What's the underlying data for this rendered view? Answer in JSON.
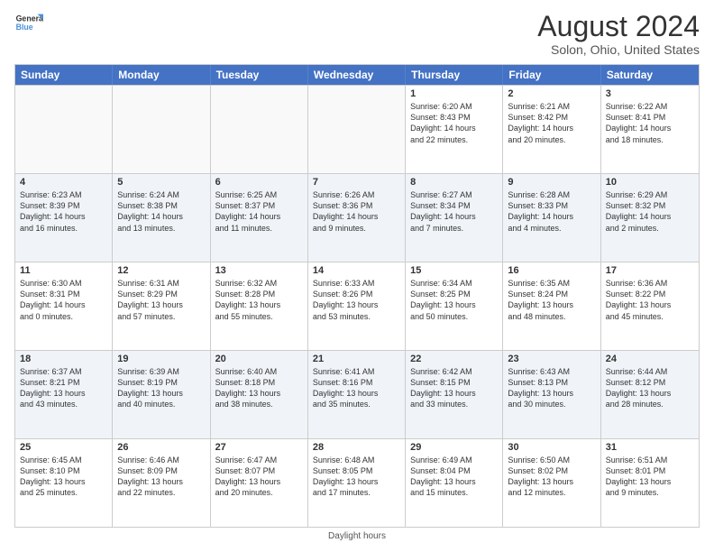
{
  "header": {
    "logo_general": "General",
    "logo_blue": "Blue",
    "month_year": "August 2024",
    "location": "Solon, Ohio, United States"
  },
  "days_of_week": [
    "Sunday",
    "Monday",
    "Tuesday",
    "Wednesday",
    "Thursday",
    "Friday",
    "Saturday"
  ],
  "footer": {
    "daylight_label": "Daylight hours"
  },
  "weeks": [
    [
      {
        "day": "",
        "info": ""
      },
      {
        "day": "",
        "info": ""
      },
      {
        "day": "",
        "info": ""
      },
      {
        "day": "",
        "info": ""
      },
      {
        "day": "1",
        "info": "Sunrise: 6:20 AM\nSunset: 8:43 PM\nDaylight: 14 hours\nand 22 minutes."
      },
      {
        "day": "2",
        "info": "Sunrise: 6:21 AM\nSunset: 8:42 PM\nDaylight: 14 hours\nand 20 minutes."
      },
      {
        "day": "3",
        "info": "Sunrise: 6:22 AM\nSunset: 8:41 PM\nDaylight: 14 hours\nand 18 minutes."
      }
    ],
    [
      {
        "day": "4",
        "info": "Sunrise: 6:23 AM\nSunset: 8:39 PM\nDaylight: 14 hours\nand 16 minutes."
      },
      {
        "day": "5",
        "info": "Sunrise: 6:24 AM\nSunset: 8:38 PM\nDaylight: 14 hours\nand 13 minutes."
      },
      {
        "day": "6",
        "info": "Sunrise: 6:25 AM\nSunset: 8:37 PM\nDaylight: 14 hours\nand 11 minutes."
      },
      {
        "day": "7",
        "info": "Sunrise: 6:26 AM\nSunset: 8:36 PM\nDaylight: 14 hours\nand 9 minutes."
      },
      {
        "day": "8",
        "info": "Sunrise: 6:27 AM\nSunset: 8:34 PM\nDaylight: 14 hours\nand 7 minutes."
      },
      {
        "day": "9",
        "info": "Sunrise: 6:28 AM\nSunset: 8:33 PM\nDaylight: 14 hours\nand 4 minutes."
      },
      {
        "day": "10",
        "info": "Sunrise: 6:29 AM\nSunset: 8:32 PM\nDaylight: 14 hours\nand 2 minutes."
      }
    ],
    [
      {
        "day": "11",
        "info": "Sunrise: 6:30 AM\nSunset: 8:31 PM\nDaylight: 14 hours\nand 0 minutes."
      },
      {
        "day": "12",
        "info": "Sunrise: 6:31 AM\nSunset: 8:29 PM\nDaylight: 13 hours\nand 57 minutes."
      },
      {
        "day": "13",
        "info": "Sunrise: 6:32 AM\nSunset: 8:28 PM\nDaylight: 13 hours\nand 55 minutes."
      },
      {
        "day": "14",
        "info": "Sunrise: 6:33 AM\nSunset: 8:26 PM\nDaylight: 13 hours\nand 53 minutes."
      },
      {
        "day": "15",
        "info": "Sunrise: 6:34 AM\nSunset: 8:25 PM\nDaylight: 13 hours\nand 50 minutes."
      },
      {
        "day": "16",
        "info": "Sunrise: 6:35 AM\nSunset: 8:24 PM\nDaylight: 13 hours\nand 48 minutes."
      },
      {
        "day": "17",
        "info": "Sunrise: 6:36 AM\nSunset: 8:22 PM\nDaylight: 13 hours\nand 45 minutes."
      }
    ],
    [
      {
        "day": "18",
        "info": "Sunrise: 6:37 AM\nSunset: 8:21 PM\nDaylight: 13 hours\nand 43 minutes."
      },
      {
        "day": "19",
        "info": "Sunrise: 6:39 AM\nSunset: 8:19 PM\nDaylight: 13 hours\nand 40 minutes."
      },
      {
        "day": "20",
        "info": "Sunrise: 6:40 AM\nSunset: 8:18 PM\nDaylight: 13 hours\nand 38 minutes."
      },
      {
        "day": "21",
        "info": "Sunrise: 6:41 AM\nSunset: 8:16 PM\nDaylight: 13 hours\nand 35 minutes."
      },
      {
        "day": "22",
        "info": "Sunrise: 6:42 AM\nSunset: 8:15 PM\nDaylight: 13 hours\nand 33 minutes."
      },
      {
        "day": "23",
        "info": "Sunrise: 6:43 AM\nSunset: 8:13 PM\nDaylight: 13 hours\nand 30 minutes."
      },
      {
        "day": "24",
        "info": "Sunrise: 6:44 AM\nSunset: 8:12 PM\nDaylight: 13 hours\nand 28 minutes."
      }
    ],
    [
      {
        "day": "25",
        "info": "Sunrise: 6:45 AM\nSunset: 8:10 PM\nDaylight: 13 hours\nand 25 minutes."
      },
      {
        "day": "26",
        "info": "Sunrise: 6:46 AM\nSunset: 8:09 PM\nDaylight: 13 hours\nand 22 minutes."
      },
      {
        "day": "27",
        "info": "Sunrise: 6:47 AM\nSunset: 8:07 PM\nDaylight: 13 hours\nand 20 minutes."
      },
      {
        "day": "28",
        "info": "Sunrise: 6:48 AM\nSunset: 8:05 PM\nDaylight: 13 hours\nand 17 minutes."
      },
      {
        "day": "29",
        "info": "Sunrise: 6:49 AM\nSunset: 8:04 PM\nDaylight: 13 hours\nand 15 minutes."
      },
      {
        "day": "30",
        "info": "Sunrise: 6:50 AM\nSunset: 8:02 PM\nDaylight: 13 hours\nand 12 minutes."
      },
      {
        "day": "31",
        "info": "Sunrise: 6:51 AM\nSunset: 8:01 PM\nDaylight: 13 hours\nand 9 minutes."
      }
    ]
  ]
}
